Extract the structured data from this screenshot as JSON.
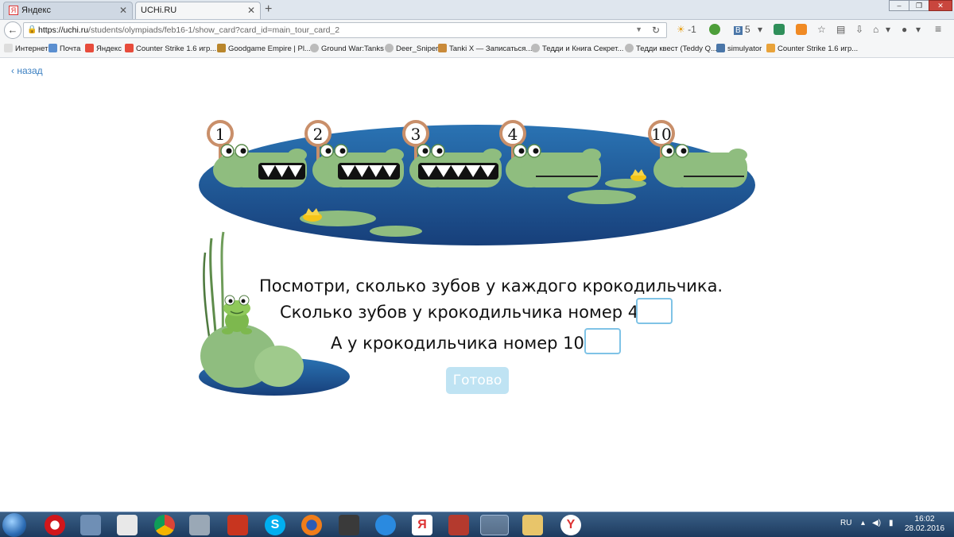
{
  "browser": {
    "tabs": [
      {
        "title": "Яндекс",
        "active": false
      },
      {
        "title": "UCHi.RU",
        "active": true
      }
    ],
    "url_host": "https://uchi.ru",
    "url_path": "/students/olympiads/feb16-1/show_card?card_id=main_tour_card_2",
    "weather": "-1",
    "vk_count": "5",
    "bookmarks": [
      "Интернет",
      "Почта",
      "Яндекс",
      "Counter Strike 1.6 игр...",
      "Goodgame Empire | Pl...",
      "Ground War:Tanks",
      "Deer_Sniper",
      "Tanki X — Записаться...",
      "Тедди и Книга Секрет...",
      "Тедди квест (Teddy Q...",
      "simulyator",
      "Counter Strike 1.6 игр..."
    ]
  },
  "page": {
    "back_label": "назад",
    "crocodile_numbers": [
      "1",
      "2",
      "3",
      "4",
      "10"
    ],
    "question_line1": "Посмотри, сколько зубов у каждого крокодильчика.",
    "question_line2": "Сколько зубов у крокодильчика номер 4?",
    "question_line3": "А у крокодильчика номер 10?",
    "answer_4": "",
    "answer_10": "",
    "done_label": "Готово"
  },
  "taskbar": {
    "lang": "RU",
    "time": "16:02",
    "date": "28.02.2016"
  },
  "colors": {
    "pond": "#1d5a99",
    "croc": "#8fbd7f",
    "accent": "#3a7fc1",
    "button_disabled": "#bfe3f3"
  }
}
